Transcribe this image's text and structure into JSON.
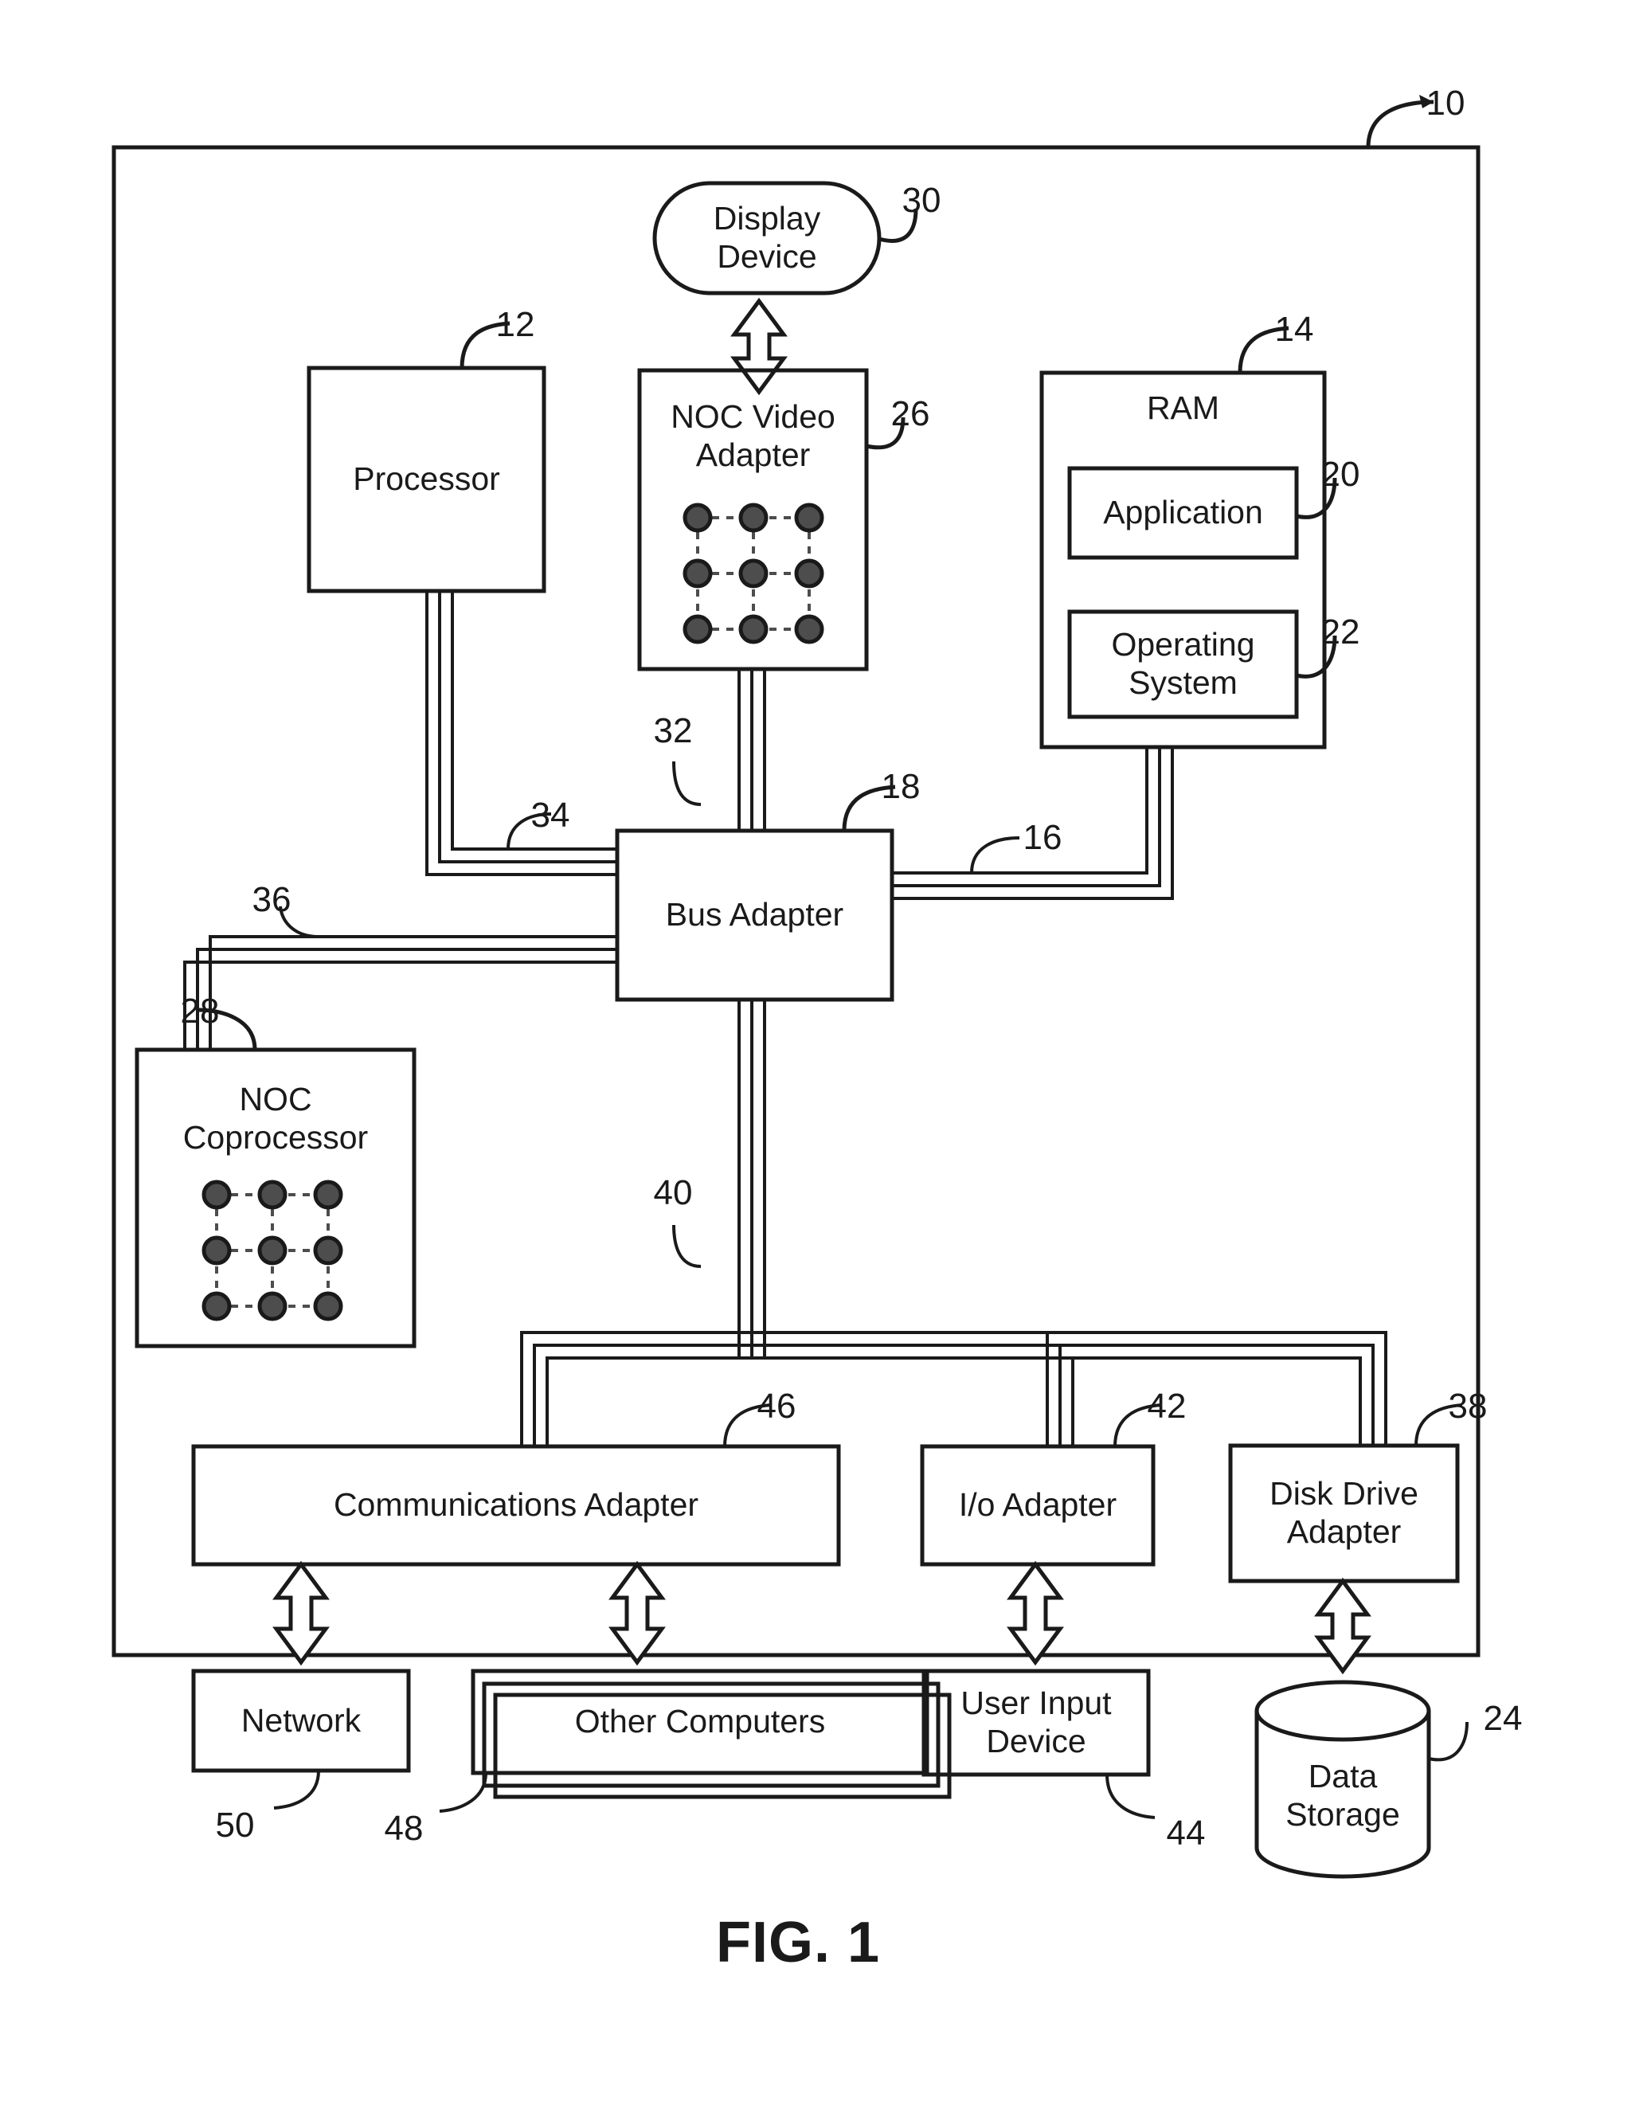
{
  "figure": {
    "caption": "FIG. 1",
    "outer_label": "10"
  },
  "blocks": [
    {
      "key": "display_device",
      "label": "Display\nDevice",
      "ref": "30",
      "shape": "stadium"
    },
    {
      "key": "processor",
      "label": "Processor",
      "ref": "12",
      "shape": "rect"
    },
    {
      "key": "noc_video_adapter",
      "label": "NOC Video\nAdapter",
      "ref": "26",
      "shape": "rect-with-mesh"
    },
    {
      "key": "ram",
      "label": "RAM",
      "ref": "14",
      "shape": "rect"
    },
    {
      "key": "application",
      "label": "Application",
      "ref": "20",
      "shape": "rect"
    },
    {
      "key": "operating_system",
      "label": "Operating\nSystem",
      "ref": "22",
      "shape": "rect"
    },
    {
      "key": "bus_adapter",
      "label": "Bus Adapter",
      "ref": "18",
      "shape": "rect"
    },
    {
      "key": "noc_coprocessor",
      "label": "NOC\nCoprocessor",
      "ref": "28",
      "shape": "rect-with-mesh"
    },
    {
      "key": "communications_adapter",
      "label": "Communications Adapter",
      "ref": "46",
      "shape": "rect"
    },
    {
      "key": "io_adapter",
      "label": "I/o Adapter",
      "ref": "42",
      "shape": "rect"
    },
    {
      "key": "disk_drive_adapter",
      "label": "Disk Drive\nAdapter",
      "ref": "38",
      "shape": "rect"
    },
    {
      "key": "network",
      "label": "Network",
      "ref": "50",
      "shape": "rect"
    },
    {
      "key": "other_computers",
      "label": "Other Computers",
      "ref": "48",
      "shape": "stacked-rect"
    },
    {
      "key": "user_input_device",
      "label": "User Input\nDevice",
      "ref": "44",
      "shape": "rect"
    },
    {
      "key": "data_storage",
      "label": "Data\nStorage",
      "ref": "24",
      "shape": "cylinder"
    }
  ],
  "buses": [
    {
      "key": "bus_video",
      "ref": "32",
      "from": "noc_video_adapter",
      "to": "bus_adapter"
    },
    {
      "key": "bus_processor",
      "ref": "34",
      "from": "processor",
      "to": "bus_adapter"
    },
    {
      "key": "bus_coprocessor",
      "ref": "36",
      "from": "noc_coprocessor",
      "to": "bus_adapter"
    },
    {
      "key": "bus_memory",
      "ref": "16",
      "from": "ram",
      "to": "bus_adapter"
    },
    {
      "key": "bus_expansion",
      "ref": "40",
      "from": "bus_adapter",
      "to": "adapters"
    }
  ],
  "style": {
    "line_color": "#1a1a1a",
    "fill_color": "#ffffff",
    "mesh_node_color": "#4d4d4d",
    "background": "#ffffff"
  }
}
